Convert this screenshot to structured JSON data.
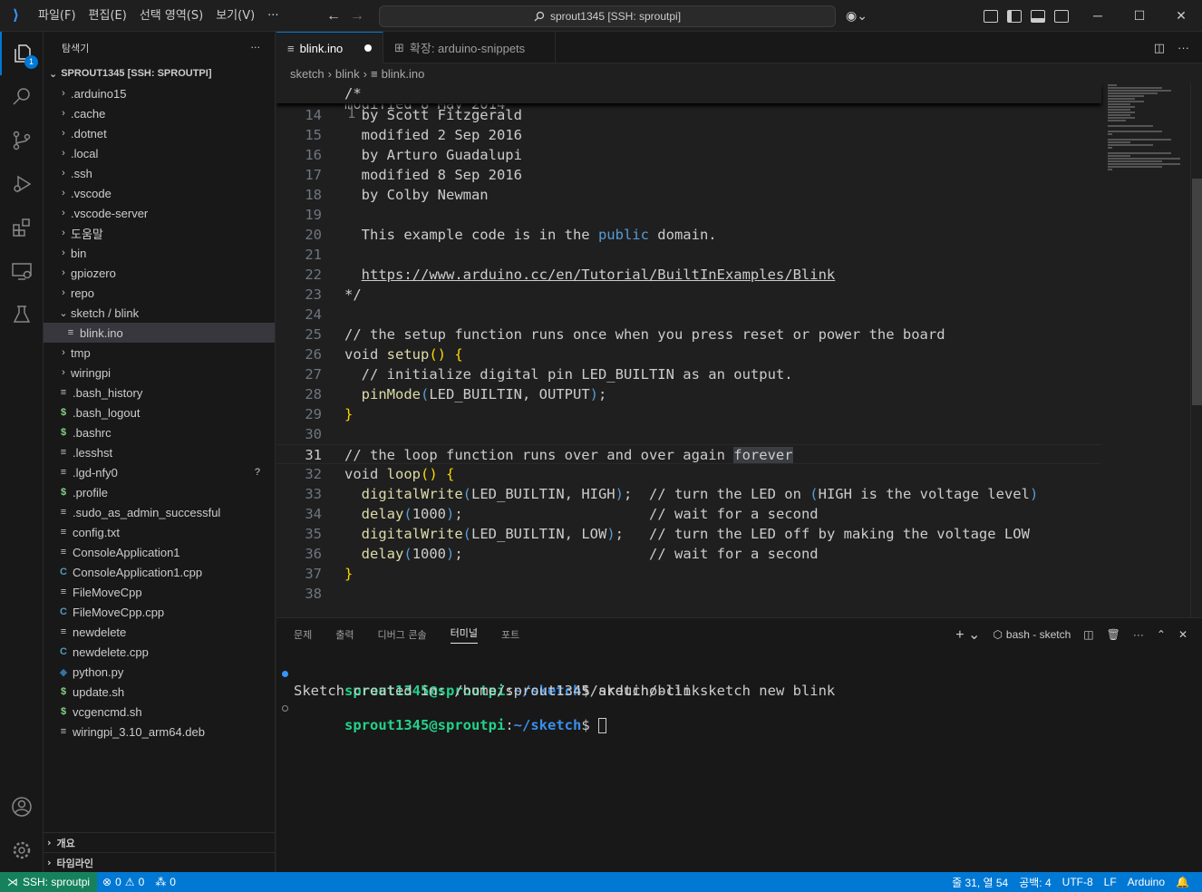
{
  "titlebar": {
    "menus": [
      "파일(F)",
      "편집(E)",
      "선택 영역(S)",
      "보기(V)",
      "···"
    ],
    "command_center": "sprout1345 [SSH: sproutpi]"
  },
  "sidebar": {
    "title": "탐색기",
    "more": "···",
    "root": "SPROUT1345 [SSH: SPROUTPI]",
    "items": [
      {
        "label": ".arduino15",
        "type": "folder"
      },
      {
        "label": ".cache",
        "type": "folder"
      },
      {
        "label": ".dotnet",
        "type": "folder"
      },
      {
        "label": ".local",
        "type": "folder"
      },
      {
        "label": ".ssh",
        "type": "folder"
      },
      {
        "label": ".vscode",
        "type": "folder"
      },
      {
        "label": ".vscode-server",
        "type": "folder"
      },
      {
        "label": "도움말",
        "type": "folder"
      },
      {
        "label": "bin",
        "type": "folder"
      },
      {
        "label": "gpiozero",
        "type": "folder"
      },
      {
        "label": "repo",
        "type": "folder"
      },
      {
        "label": "sketch / blink",
        "type": "folder-open"
      },
      {
        "label": "blink.ino",
        "type": "file",
        "nested": true,
        "selected": true
      },
      {
        "label": "tmp",
        "type": "folder"
      },
      {
        "label": "wiringpi",
        "type": "folder"
      },
      {
        "label": ".bash_history",
        "type": "file"
      },
      {
        "label": ".bash_logout",
        "type": "shell"
      },
      {
        "label": ".bashrc",
        "type": "shell"
      },
      {
        "label": ".lesshst",
        "type": "file"
      },
      {
        "label": ".lgd-nfy0",
        "type": "file",
        "decoration": "?"
      },
      {
        "label": ".profile",
        "type": "shell"
      },
      {
        "label": ".sudo_as_admin_successful",
        "type": "file"
      },
      {
        "label": "config.txt",
        "type": "file"
      },
      {
        "label": "ConsoleApplication1",
        "type": "file"
      },
      {
        "label": "ConsoleApplication1.cpp",
        "type": "cpp"
      },
      {
        "label": "FileMoveCpp",
        "type": "file"
      },
      {
        "label": "FileMoveCpp.cpp",
        "type": "cpp"
      },
      {
        "label": "newdelete",
        "type": "file"
      },
      {
        "label": "newdelete.cpp",
        "type": "cpp"
      },
      {
        "label": "python.py",
        "type": "python"
      },
      {
        "label": "update.sh",
        "type": "shell"
      },
      {
        "label": "vcgencmd.sh",
        "type": "shell"
      },
      {
        "label": "wiringpi_3.10_arm64.deb",
        "type": "file"
      }
    ],
    "bottom_sections": [
      "개요",
      "타임라인"
    ]
  },
  "activity_badge": "1",
  "tabs": [
    {
      "label": "blink.ino",
      "active": true,
      "modified": true
    },
    {
      "label": "확장: arduino-snippets",
      "active": false
    }
  ],
  "breadcrumbs": [
    "sketch",
    "blink",
    "blink.ino"
  ],
  "editor": {
    "sticky_line": {
      "num": "1",
      "text": "/*"
    },
    "lines": [
      {
        "num": "14",
        "segs": [
          [
            "  by Scott Fitzgerald",
            ""
          ]
        ]
      },
      {
        "num": "15",
        "segs": [
          [
            "  modified 2 Sep 2016",
            ""
          ]
        ]
      },
      {
        "num": "16",
        "segs": [
          [
            "  by Arturo Guadalupi",
            ""
          ]
        ]
      },
      {
        "num": "17",
        "segs": [
          [
            "  modified 8 Sep 2016",
            ""
          ]
        ]
      },
      {
        "num": "18",
        "segs": [
          [
            "  by Colby Newman",
            ""
          ]
        ]
      },
      {
        "num": "19",
        "segs": []
      },
      {
        "num": "20",
        "segs": [
          [
            "  This example code is in the ",
            ""
          ],
          [
            "public",
            "kw"
          ],
          [
            " domain.",
            ""
          ]
        ]
      },
      {
        "num": "21",
        "segs": []
      },
      {
        "num": "22",
        "segs": [
          [
            "  ",
            ""
          ],
          [
            "https://www.arduino.cc/en/Tutorial/BuiltInExamples/Blink",
            "link"
          ]
        ]
      },
      {
        "num": "23",
        "segs": [
          [
            "*/",
            ""
          ]
        ]
      },
      {
        "num": "24",
        "segs": []
      },
      {
        "num": "25",
        "segs": [
          [
            "// the setup function runs once when you press reset or power the board",
            ""
          ]
        ]
      },
      {
        "num": "26",
        "segs": [
          [
            "void ",
            ""
          ],
          [
            "setup",
            "fn"
          ],
          [
            "()",
            "brk"
          ],
          [
            " ",
            ""
          ],
          [
            "{",
            "brk"
          ]
        ]
      },
      {
        "num": "27",
        "segs": [
          [
            "  // initialize digital pin LED_BUILTIN as an output.",
            ""
          ]
        ]
      },
      {
        "num": "28",
        "segs": [
          [
            "  ",
            ""
          ],
          [
            "pinMode",
            "fn"
          ],
          [
            "(",
            "kw"
          ],
          [
            "LED_BUILTIN, OUTPUT",
            ""
          ],
          [
            ")",
            "kw"
          ],
          [
            ";",
            ""
          ]
        ]
      },
      {
        "num": "29",
        "segs": [
          [
            "}",
            "brk"
          ]
        ]
      },
      {
        "num": "30",
        "segs": []
      },
      {
        "num": "31",
        "segs": [
          [
            "// the loop function runs over and over again ",
            ""
          ],
          [
            "forever",
            "hl"
          ]
        ],
        "current": true
      },
      {
        "num": "32",
        "segs": [
          [
            "void ",
            ""
          ],
          [
            "loop",
            "fn"
          ],
          [
            "()",
            "brk"
          ],
          [
            " ",
            ""
          ],
          [
            "{",
            "brk"
          ]
        ]
      },
      {
        "num": "33",
        "segs": [
          [
            "  ",
            ""
          ],
          [
            "digitalWrite",
            "fn"
          ],
          [
            "(",
            "kw"
          ],
          [
            "LED_BUILTIN, HIGH",
            ""
          ],
          [
            ")",
            "kw"
          ],
          [
            ";  // turn the LED on ",
            ""
          ],
          [
            "(",
            "kw"
          ],
          [
            "HIGH is the voltage level",
            ""
          ],
          [
            ")",
            "kw"
          ]
        ]
      },
      {
        "num": "34",
        "segs": [
          [
            "  ",
            ""
          ],
          [
            "delay",
            "fn"
          ],
          [
            "(",
            "kw"
          ],
          [
            "1000",
            ""
          ],
          [
            ")",
            "kw"
          ],
          [
            ";                      // wait for a second",
            ""
          ]
        ]
      },
      {
        "num": "35",
        "segs": [
          [
            "  ",
            ""
          ],
          [
            "digitalWrite",
            "fn"
          ],
          [
            "(",
            "kw"
          ],
          [
            "LED_BUILTIN, LOW",
            ""
          ],
          [
            ")",
            "kw"
          ],
          [
            ";   // turn the LED off by making the voltage LOW",
            ""
          ]
        ]
      },
      {
        "num": "36",
        "segs": [
          [
            "  ",
            ""
          ],
          [
            "delay",
            "fn"
          ],
          [
            "(",
            "kw"
          ],
          [
            "1000",
            ""
          ],
          [
            ")",
            "kw"
          ],
          [
            ";                      // wait for a second",
            ""
          ]
        ]
      },
      {
        "num": "37",
        "segs": [
          [
            "}",
            "brk"
          ]
        ]
      },
      {
        "num": "38",
        "segs": []
      }
    ],
    "peek_text": "  modified 8 May 2014"
  },
  "panel": {
    "tabs": [
      "문제",
      "출력",
      "디버그 콘솔",
      "터미널",
      "포트"
    ],
    "active_tab": "터미널",
    "terminal_name": "bash - sketch",
    "terminal": {
      "line1_user": "sprout1345@sproutpi",
      "line1_path": "~/sketch",
      "line1_cmd": "$ arduino-cli sketch new blink",
      "line2": "Sketch created in: /home/sprout1345/sketch/blink",
      "line3_user": "sprout1345@sproutpi",
      "line3_path": "~/sketch",
      "line3_cmd": "$ "
    }
  },
  "statusbar": {
    "remote": "SSH: sproutpi",
    "errors": "0",
    "warnings": "0",
    "ports": "0",
    "position": "줄 31, 열 54",
    "spaces": "공백: 4",
    "encoding": "UTF-8",
    "eol": "LF",
    "language": "Arduino"
  }
}
